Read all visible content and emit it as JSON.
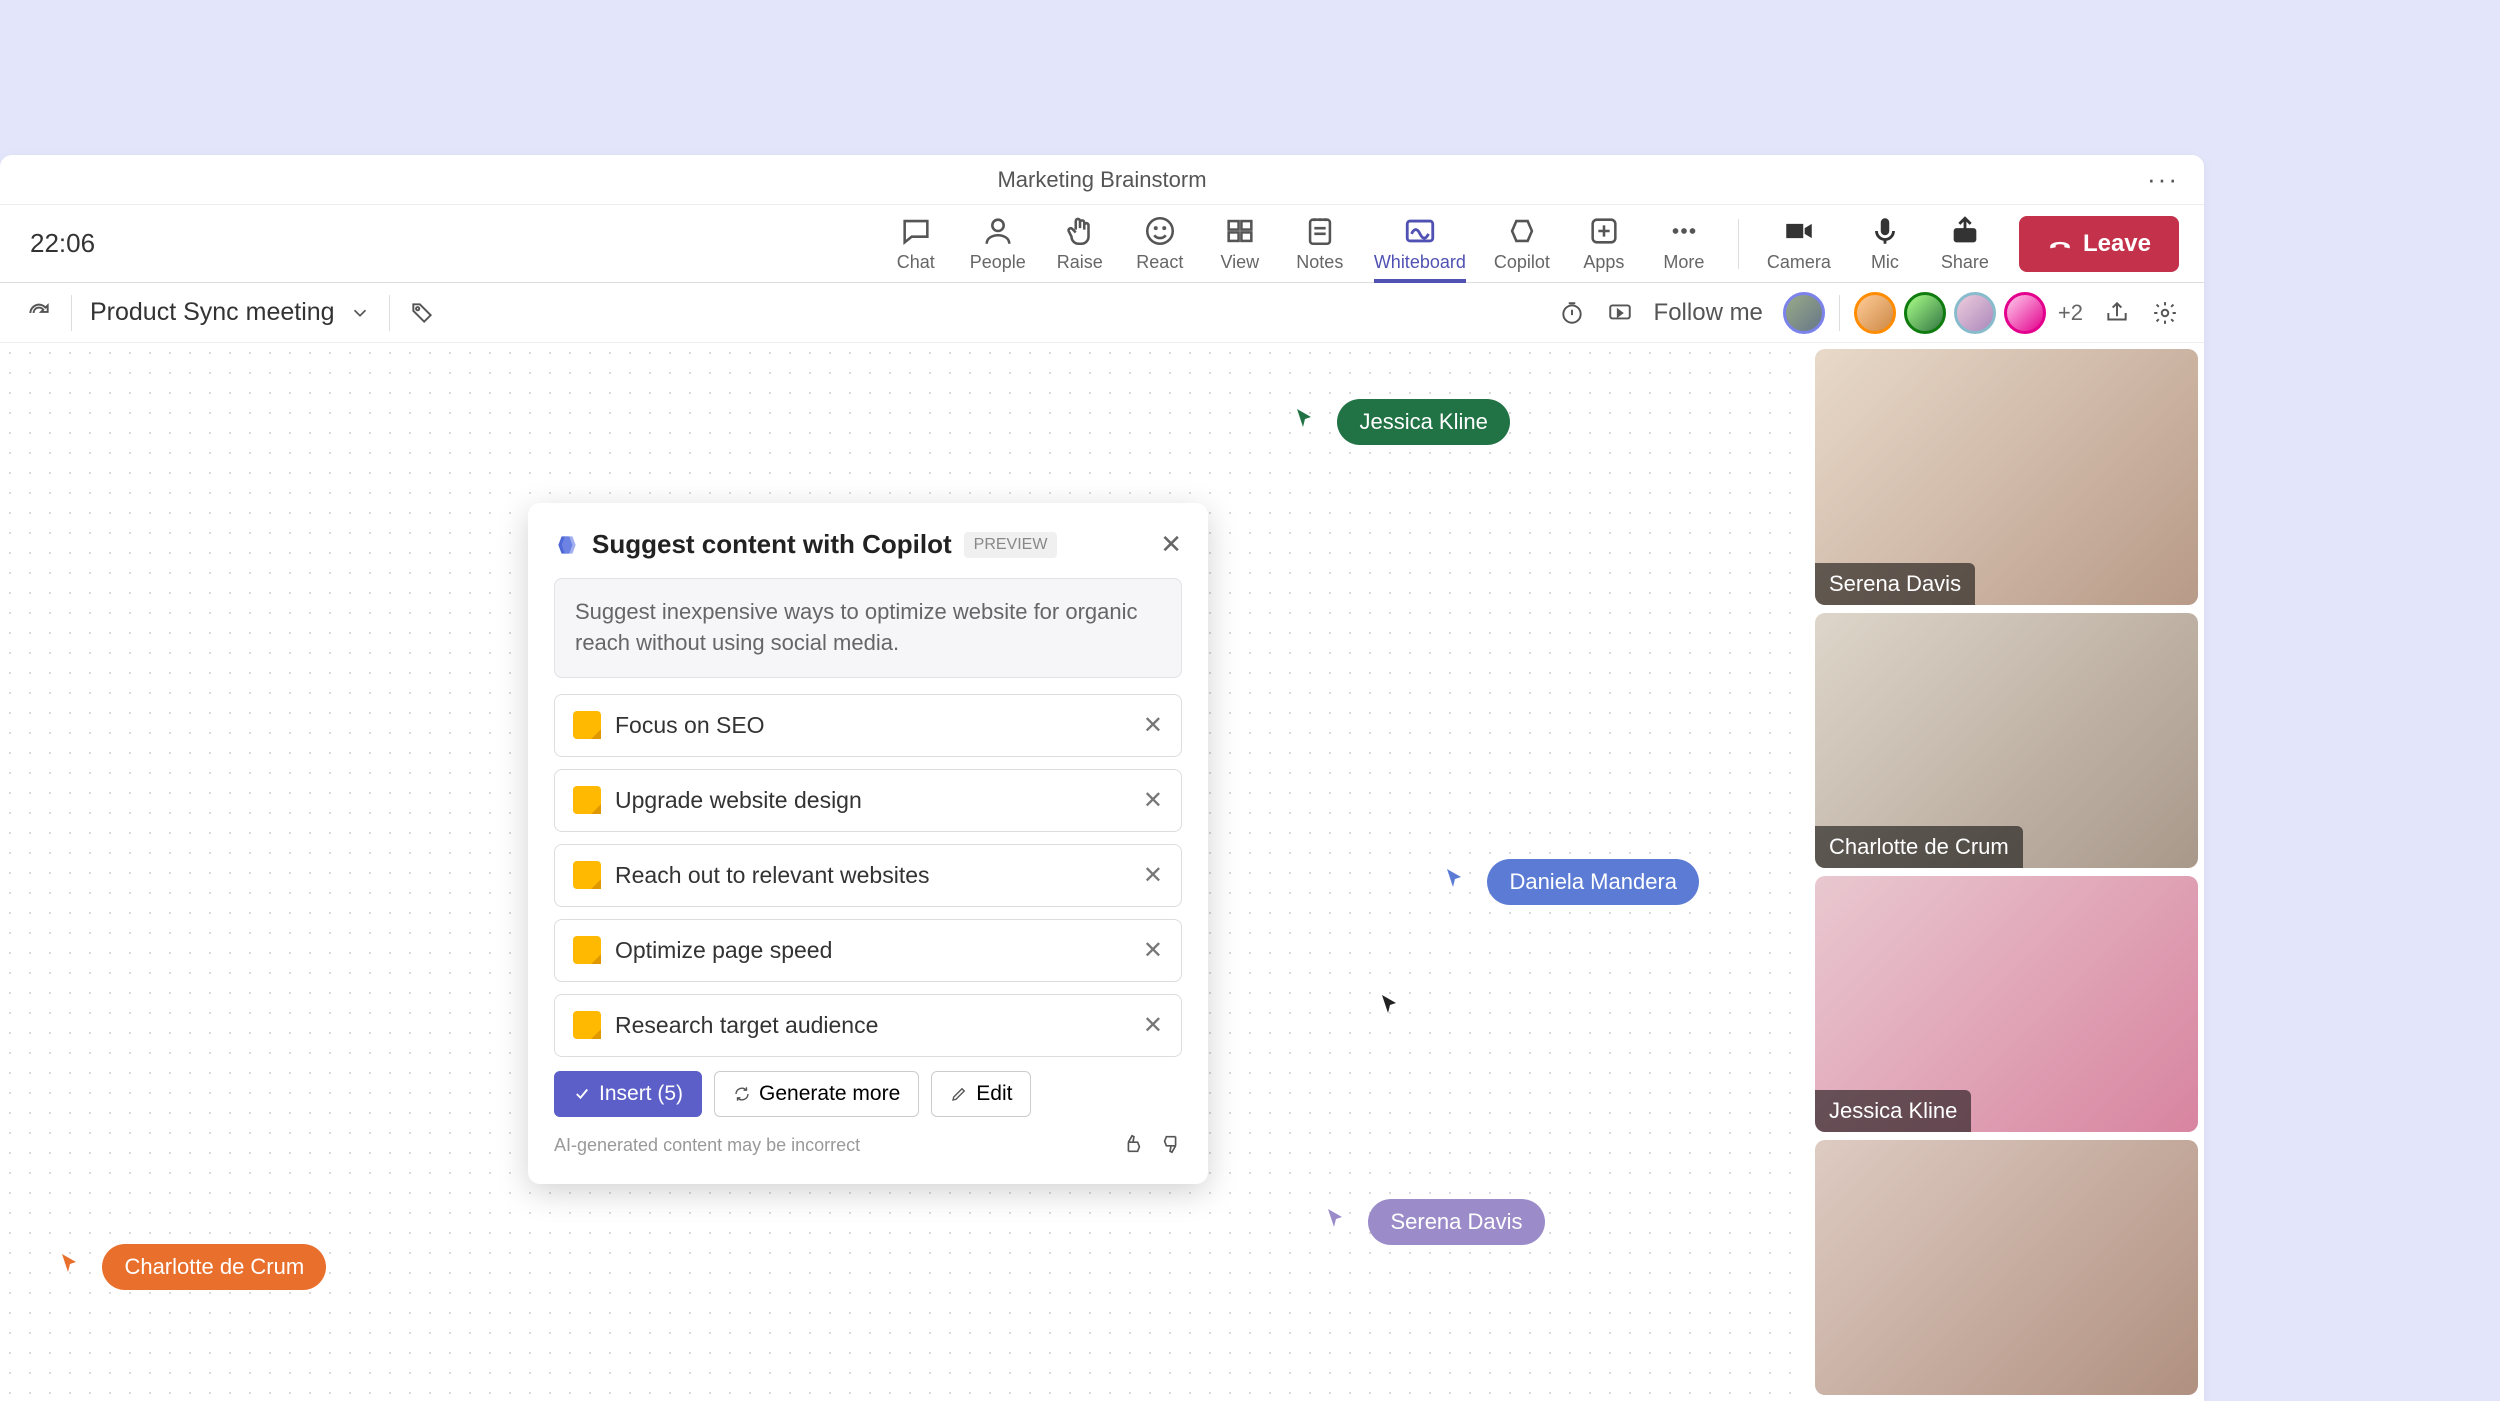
{
  "titlebar": {
    "title": "Marketing Brainstorm"
  },
  "meeting": {
    "timer": "22:06",
    "leave_label": "Leave",
    "tools": {
      "chat": "Chat",
      "people": "People",
      "raise": "Raise",
      "react": "React",
      "view": "View",
      "notes": "Notes",
      "whiteboard": "Whiteboard",
      "copilot": "Copilot",
      "apps": "Apps",
      "more": "More",
      "camera": "Camera",
      "mic": "Mic",
      "share": "Share"
    }
  },
  "secondary": {
    "meeting_name": "Product Sync meeting",
    "follow_me": "Follow me",
    "avatar_more": "+2"
  },
  "cursors": {
    "jessica": "Jessica Kline",
    "daniela": "Daniela Mandera",
    "serena": "Serena Davis",
    "charlotte": "Charlotte de Crum"
  },
  "participants": [
    {
      "name": "Serena Davis"
    },
    {
      "name": "Charlotte de Crum"
    },
    {
      "name": "Jessica Kline"
    },
    {
      "name": ""
    }
  ],
  "copilot": {
    "title": "Suggest content with Copilot",
    "badge": "PREVIEW",
    "prompt": "Suggest inexpensive ways to optimize website for organic reach without using social media.",
    "suggestions": [
      "Focus on SEO",
      "Upgrade website design",
      "Reach out to relevant websites",
      "Optimize page speed",
      "Research target audience"
    ],
    "actions": {
      "insert": "Insert (5)",
      "generate": "Generate more",
      "edit": "Edit"
    },
    "disclaimer": "AI-generated content may be incorrect"
  }
}
